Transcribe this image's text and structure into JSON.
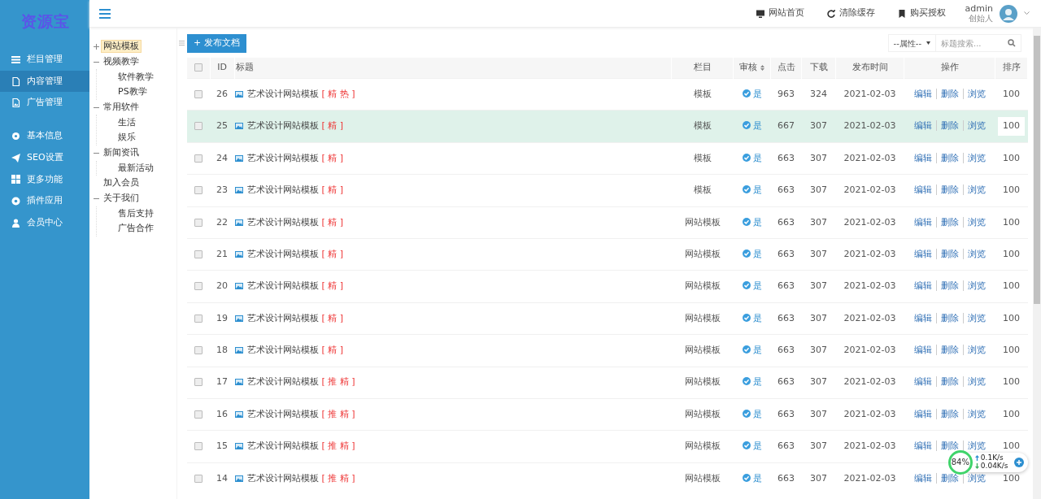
{
  "logo": "资源宝",
  "sidebar": {
    "groups": [
      [
        {
          "label": "栏目管理",
          "selected": false
        },
        {
          "label": "内容管理",
          "selected": true
        },
        {
          "label": "广告管理",
          "selected": false
        }
      ],
      [
        {
          "label": "基本信息",
          "selected": false
        },
        {
          "label": "SEO设置",
          "selected": false
        },
        {
          "label": "更多功能",
          "selected": false
        },
        {
          "label": "插件应用",
          "selected": false
        },
        {
          "label": "会员中心",
          "selected": false
        }
      ]
    ]
  },
  "topbar": {
    "links": [
      "网站首页",
      "清除缓存",
      "购买授权"
    ],
    "user": {
      "name": "admin",
      "role": "创始人"
    }
  },
  "tree": [
    {
      "label": "网站模板",
      "selected": true,
      "expanded": false
    },
    {
      "label": "视频教学",
      "selected": false,
      "expanded": true,
      "children": [
        {
          "label": "软件教学",
          "selected": false
        },
        {
          "label": "PS教学",
          "selected": false
        }
      ]
    },
    {
      "label": "常用软件",
      "selected": false,
      "expanded": true,
      "children": [
        {
          "label": "生活",
          "selected": false
        },
        {
          "label": "娱乐",
          "selected": false
        }
      ]
    },
    {
      "label": "新闻资讯",
      "selected": false,
      "expanded": true,
      "children": [
        {
          "label": "最新活动",
          "selected": false
        }
      ]
    },
    {
      "label": "加入会员",
      "selected": false
    },
    {
      "label": "关于我们",
      "selected": false,
      "expanded": true,
      "children": [
        {
          "label": "售后支持",
          "selected": false
        },
        {
          "label": "广告合作",
          "selected": false
        }
      ]
    }
  ],
  "toolbar": {
    "publish_button": "+ 发布文档",
    "filter_select": "--属性--",
    "search": {
      "placeholder": "标题搜索..."
    }
  },
  "table": {
    "select_all_checked": false,
    "columns": [
      "ID",
      "标题",
      "栏目",
      "审核",
      "点击",
      "下载",
      "发布时间",
      "操作",
      "排序"
    ],
    "rows": [
      {
        "checked": false,
        "hovered": false,
        "id": "26",
        "title": "艺术设计网站模板",
        "tag": "[ 精 热 ]",
        "column": "模板",
        "status": "是",
        "clicks": "963",
        "downloads": "324",
        "date": "2021-02-03",
        "actions": [
          "编辑",
          "删除",
          "浏览"
        ],
        "sort": "100"
      },
      {
        "checked": false,
        "hovered": true,
        "id": "25",
        "title": "艺术设计网站模板",
        "tag": "[ 精 ]",
        "column": "模板",
        "status": "是",
        "clicks": "667",
        "downloads": "307",
        "date": "2021-02-03",
        "actions": [
          "编辑",
          "删除",
          "浏览"
        ],
        "sort": "100"
      },
      {
        "checked": false,
        "hovered": false,
        "id": "24",
        "title": "艺术设计网站模板",
        "tag": "[ 精 ]",
        "column": "模板",
        "status": "是",
        "clicks": "663",
        "downloads": "307",
        "date": "2021-02-03",
        "actions": [
          "编辑",
          "删除",
          "浏览"
        ],
        "sort": "100"
      },
      {
        "checked": false,
        "hovered": false,
        "id": "23",
        "title": "艺术设计网站模板",
        "tag": "[ 精 ]",
        "column": "模板",
        "status": "是",
        "clicks": "663",
        "downloads": "307",
        "date": "2021-02-03",
        "actions": [
          "编辑",
          "删除",
          "浏览"
        ],
        "sort": "100"
      },
      {
        "checked": false,
        "hovered": false,
        "id": "22",
        "title": "艺术设计网站模板",
        "tag": "[ 精 ]",
        "column": "网站模板",
        "status": "是",
        "clicks": "663",
        "downloads": "307",
        "date": "2021-02-03",
        "actions": [
          "编辑",
          "删除",
          "浏览"
        ],
        "sort": "100"
      },
      {
        "checked": false,
        "hovered": false,
        "id": "21",
        "title": "艺术设计网站模板",
        "tag": "[ 精 ]",
        "column": "网站模板",
        "status": "是",
        "clicks": "663",
        "downloads": "307",
        "date": "2021-02-03",
        "actions": [
          "编辑",
          "删除",
          "浏览"
        ],
        "sort": "100"
      },
      {
        "checked": false,
        "hovered": false,
        "id": "20",
        "title": "艺术设计网站模板",
        "tag": "[ 精 ]",
        "column": "网站模板",
        "status": "是",
        "clicks": "663",
        "downloads": "307",
        "date": "2021-02-03",
        "actions": [
          "编辑",
          "删除",
          "浏览"
        ],
        "sort": "100"
      },
      {
        "checked": false,
        "hovered": false,
        "id": "19",
        "title": "艺术设计网站模板",
        "tag": "[ 精 ]",
        "column": "网站模板",
        "status": "是",
        "clicks": "663",
        "downloads": "307",
        "date": "2021-02-03",
        "actions": [
          "编辑",
          "删除",
          "浏览"
        ],
        "sort": "100"
      },
      {
        "checked": false,
        "hovered": false,
        "id": "18",
        "title": "艺术设计网站模板",
        "tag": "[ 精 ]",
        "column": "网站模板",
        "status": "是",
        "clicks": "663",
        "downloads": "307",
        "date": "2021-02-03",
        "actions": [
          "编辑",
          "删除",
          "浏览"
        ],
        "sort": "100"
      },
      {
        "checked": false,
        "hovered": false,
        "id": "17",
        "title": "艺术设计网站模板",
        "tag": "[ 推 精 ]",
        "column": "网站模板",
        "status": "是",
        "clicks": "663",
        "downloads": "307",
        "date": "2021-02-03",
        "actions": [
          "编辑",
          "删除",
          "浏览"
        ],
        "sort": "100"
      },
      {
        "checked": false,
        "hovered": false,
        "id": "16",
        "title": "艺术设计网站模板",
        "tag": "[ 推 精 ]",
        "column": "网站模板",
        "status": "是",
        "clicks": "663",
        "downloads": "307",
        "date": "2021-02-03",
        "actions": [
          "编辑",
          "删除",
          "浏览"
        ],
        "sort": "100"
      },
      {
        "checked": false,
        "hovered": false,
        "id": "15",
        "title": "艺术设计网站模板",
        "tag": "[ 推 精 ]",
        "column": "网站模板",
        "status": "是",
        "clicks": "663",
        "downloads": "307",
        "date": "2021-02-03",
        "actions": [
          "编辑",
          "删除",
          "浏览"
        ],
        "sort": "100"
      },
      {
        "checked": false,
        "hovered": false,
        "id": "14",
        "title": "艺术设计网站模板",
        "tag": "[ 推 精 ]",
        "column": "网站模板",
        "status": "是",
        "clicks": "663",
        "downloads": "307",
        "date": "2021-02-03",
        "actions": [
          "编辑",
          "删除",
          "浏览"
        ],
        "sort": "100"
      }
    ]
  },
  "speed_widget": {
    "percent": "84%",
    "upload": "0.1K/s",
    "download": "0.04K/s"
  }
}
